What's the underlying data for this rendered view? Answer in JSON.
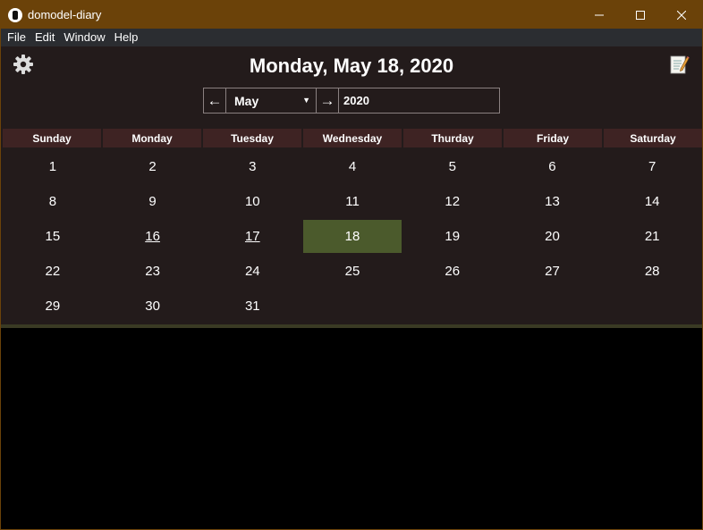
{
  "window": {
    "title": "domodel-diary",
    "controls": [
      "minimize",
      "maximize",
      "close"
    ]
  },
  "menu": [
    "File",
    "Edit",
    "Window",
    "Help"
  ],
  "header": {
    "title": "Monday, May 18, 2020",
    "settings_icon": "gear-icon",
    "note_icon": "notepad-icon"
  },
  "nav": {
    "prev": "←",
    "next": "→",
    "month": "May",
    "year": "2020"
  },
  "calendar": {
    "weekdays": [
      "Sunday",
      "Monday",
      "Tuesday",
      "Wednesday",
      "Thurday",
      "Friday",
      "Saturday"
    ],
    "weeks": [
      [
        "1",
        "2",
        "3",
        "4",
        "5",
        "6",
        "7"
      ],
      [
        "8",
        "9",
        "10",
        "11",
        "12",
        "13",
        "14"
      ],
      [
        "15",
        "16",
        "17",
        "18",
        "19",
        "20",
        "21"
      ],
      [
        "22",
        "23",
        "24",
        "25",
        "26",
        "27",
        "28"
      ],
      [
        "29",
        "30",
        "31",
        "",
        "",
        "",
        ""
      ]
    ],
    "selected_day": "18",
    "days_with_entries": [
      "16",
      "17"
    ],
    "colors": {
      "background": "#231b1b",
      "header": "#3e2323",
      "selected": "#4b5a2c",
      "titlebar": "#6b4209"
    }
  },
  "editor": {
    "content": ""
  }
}
